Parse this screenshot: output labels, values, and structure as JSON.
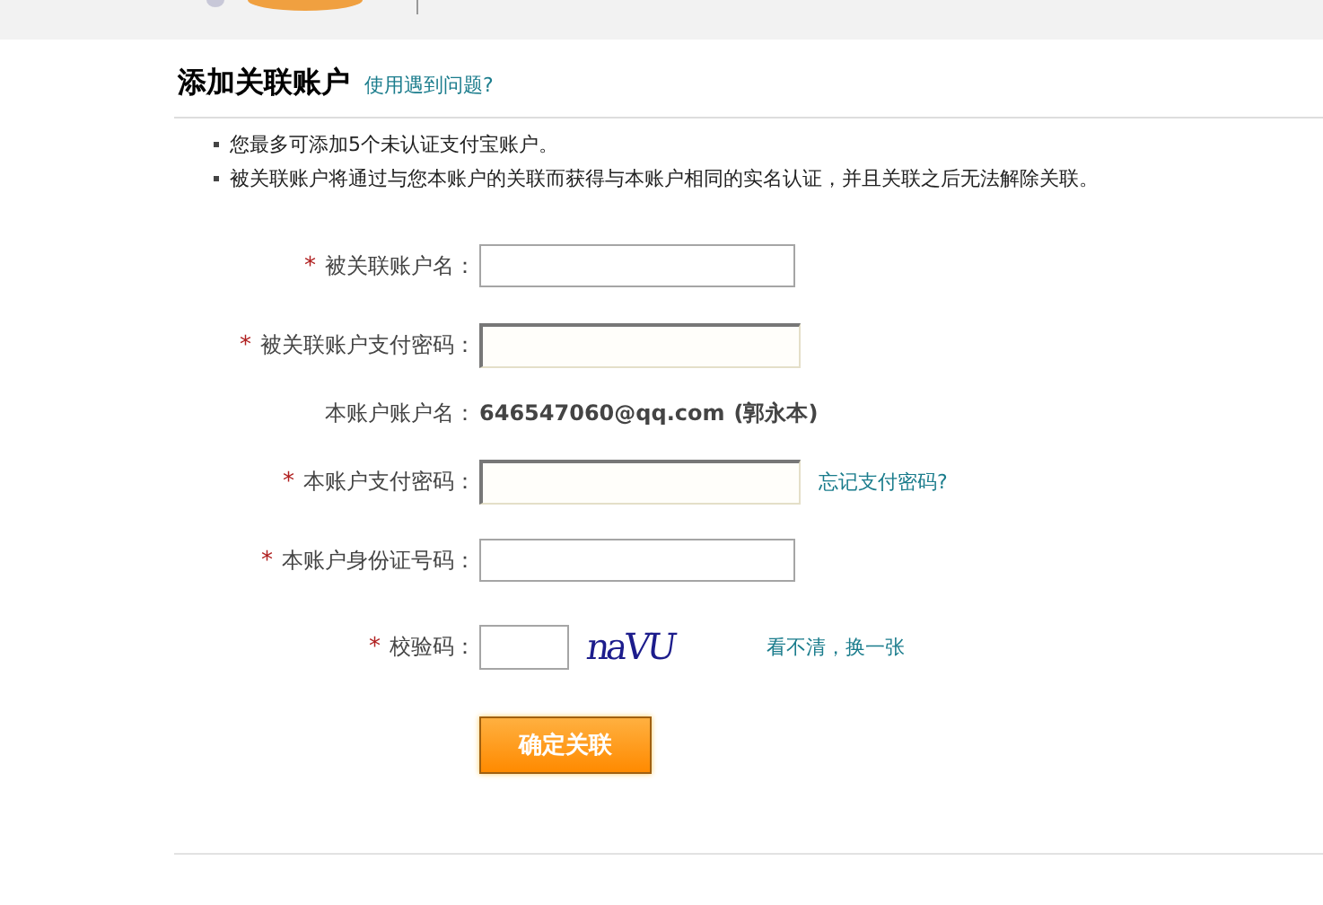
{
  "title": "添加关联账户",
  "help_link": "使用遇到问题?",
  "notes": [
    "您最多可添加5个未认证支付宝账户。",
    "被关联账户将通过与您本账户的关联而获得与本账户相同的实名认证，并且关联之后无法解除关联。"
  ],
  "fields": [
    {
      "kind": "text",
      "mark": "*",
      "label": "被关联账户名："
    },
    {
      "kind": "password",
      "mark": "*",
      "label": "被关联账户支付密码："
    },
    {
      "kind": "static",
      "label": "本账户账户名：",
      "value": "646547060@qq.com",
      "extra": "(郭永本)"
    },
    {
      "kind": "password",
      "mark": "*",
      "label": "本账户支付密码：",
      "link": "忘记支付密码?"
    },
    {
      "kind": "text",
      "mark": "*",
      "label": "本账户身份证号码："
    },
    {
      "kind": "captcha",
      "mark": "*",
      "label": "校验码：",
      "captcha": "naVU",
      "link": "看不清，换一张"
    }
  ],
  "submit": "确定关联"
}
